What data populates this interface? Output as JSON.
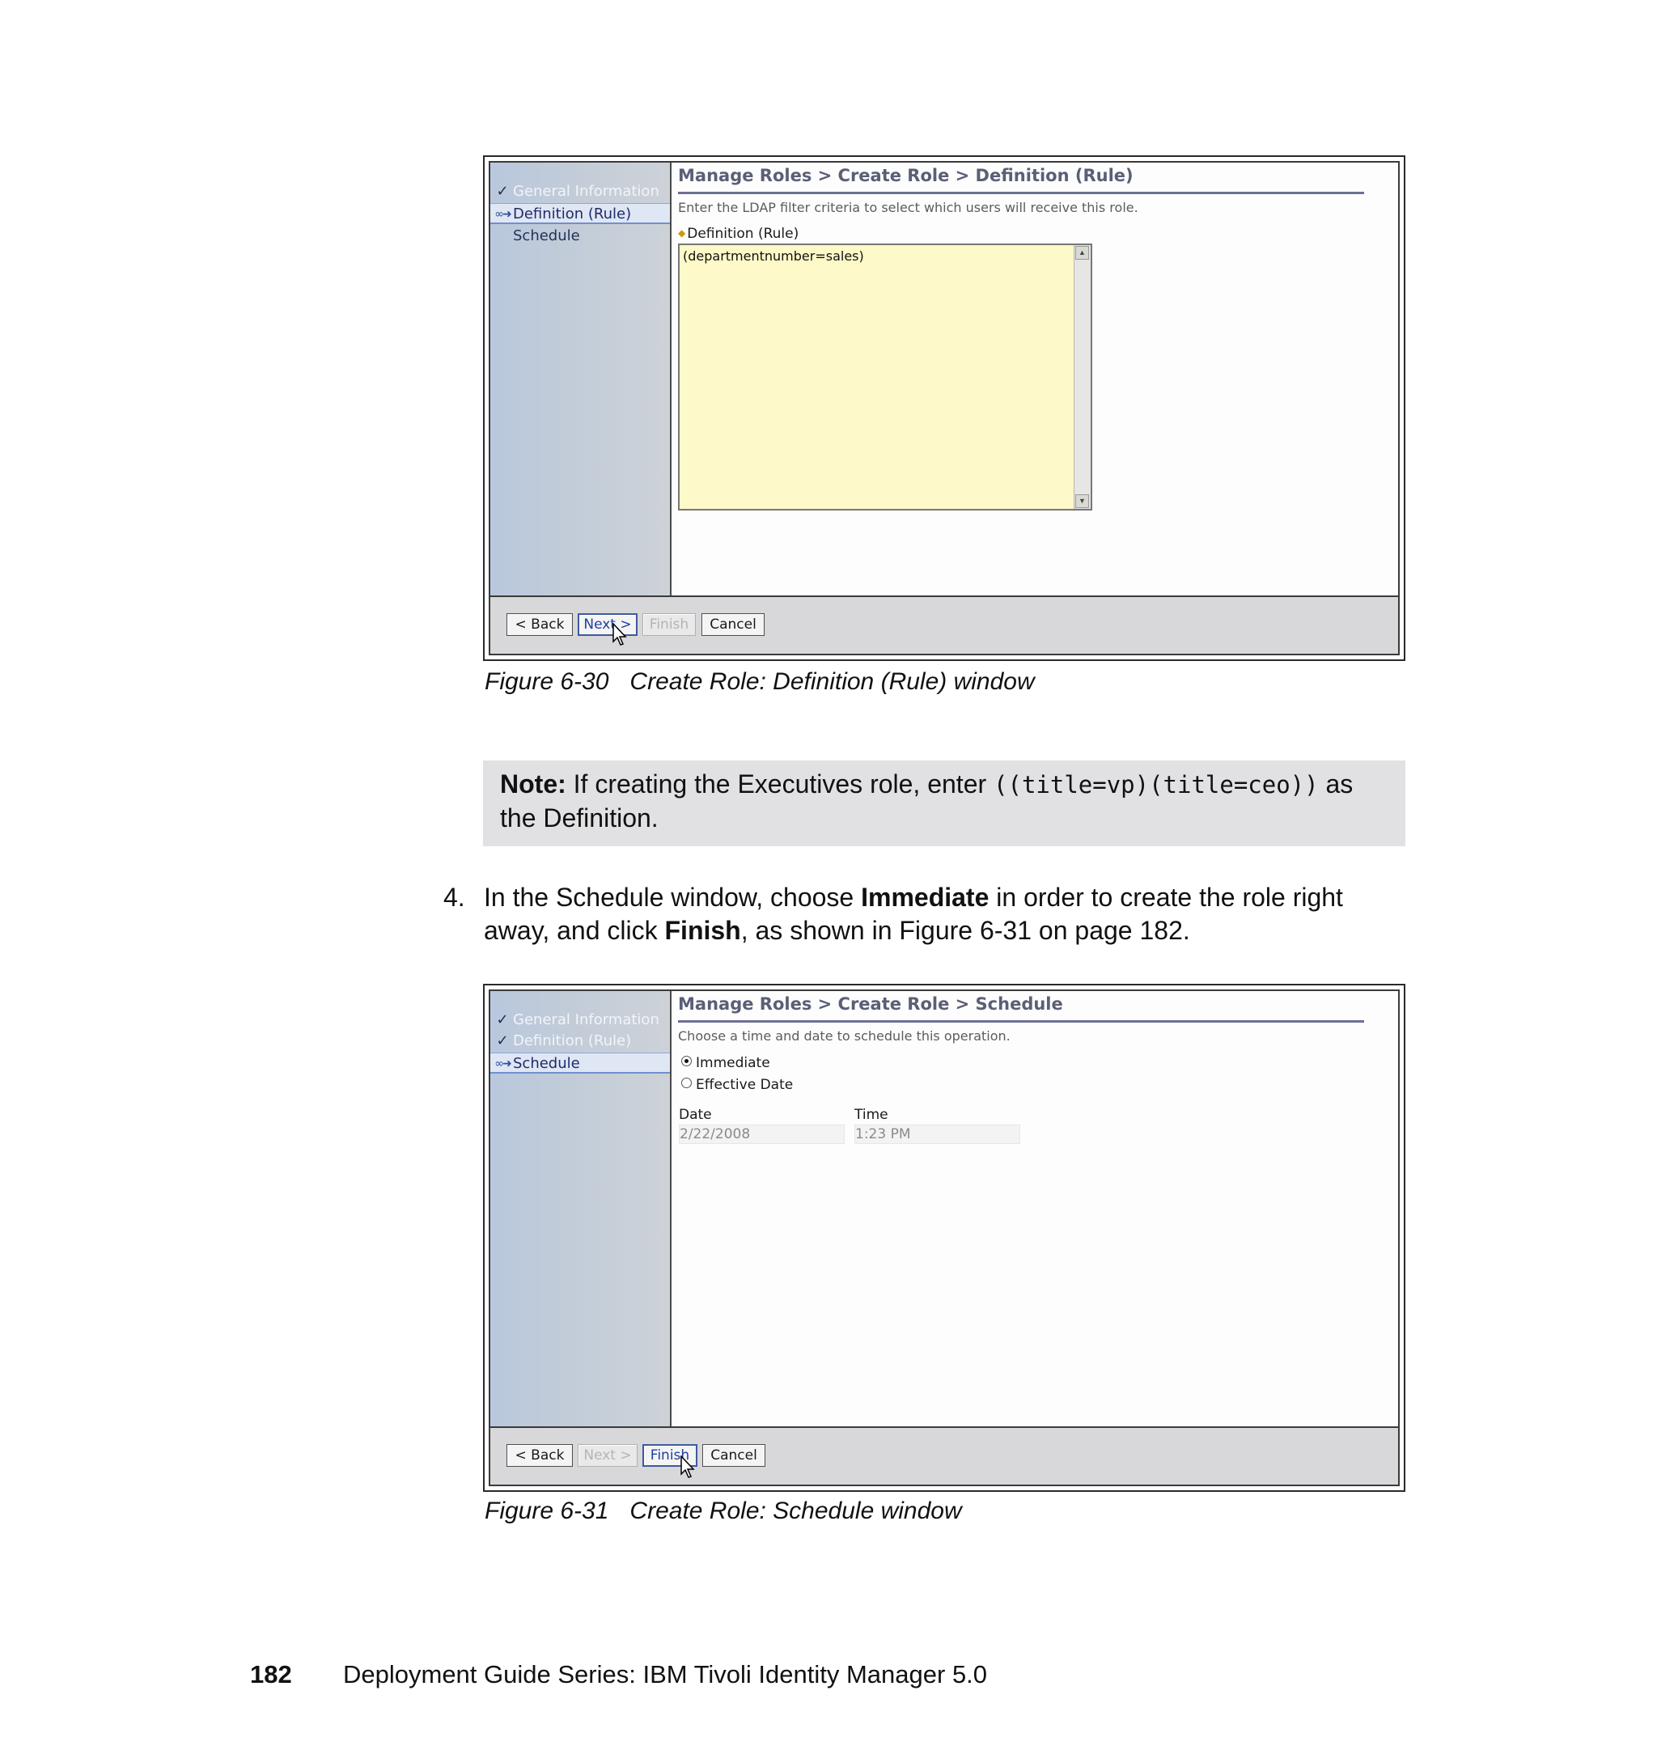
{
  "figure1": {
    "nav": {
      "general_information": "General Information",
      "definition_rule": "Definition (Rule)",
      "schedule": "Schedule"
    },
    "breadcrumb": "Manage Roles > Create Role > Definition (Rule)",
    "instruction": "Enter the LDAP filter criteria to select which users will receive this role.",
    "field_label": "Definition (Rule)",
    "field_value": "(departmentnumber=sales)",
    "buttons": {
      "back": "< Back",
      "next": "Next >",
      "finish": "Finish",
      "cancel": "Cancel"
    },
    "caption_number": "Figure 6-30",
    "caption_title": "Create Role: Definition (Rule) window"
  },
  "note": {
    "label": "Note:",
    "text_before": " If creating the Executives role, enter ",
    "code": "((title=vp)(title=ceo))",
    "text_after": " as the Definition."
  },
  "step": {
    "number": "4.",
    "text_1": "In the Schedule window, choose ",
    "bold_1": "Immediate",
    "text_2": " in order to create the role right away, and click ",
    "bold_2": "Finish",
    "text_3": ", as shown in Figure 6-31 on page 182."
  },
  "figure2": {
    "nav": {
      "general_information": "General Information",
      "definition_rule": "Definition (Rule)",
      "schedule": "Schedule"
    },
    "breadcrumb": "Manage Roles > Create Role > Schedule",
    "instruction": "Choose a time and date to schedule this operation.",
    "radio_immediate": "Immediate",
    "radio_effective_date": "Effective Date",
    "date_label": "Date",
    "date_value": "2/22/2008",
    "time_label": "Time",
    "time_value": "1:23 PM",
    "buttons": {
      "back": "< Back",
      "next": "Next >",
      "finish": "Finish",
      "cancel": "Cancel"
    },
    "caption_number": "Figure 6-31",
    "caption_title": "Create Role: Schedule window"
  },
  "page_footer": {
    "page_number": "182",
    "title": "Deployment Guide Series: IBM Tivoli Identity Manager 5.0"
  }
}
